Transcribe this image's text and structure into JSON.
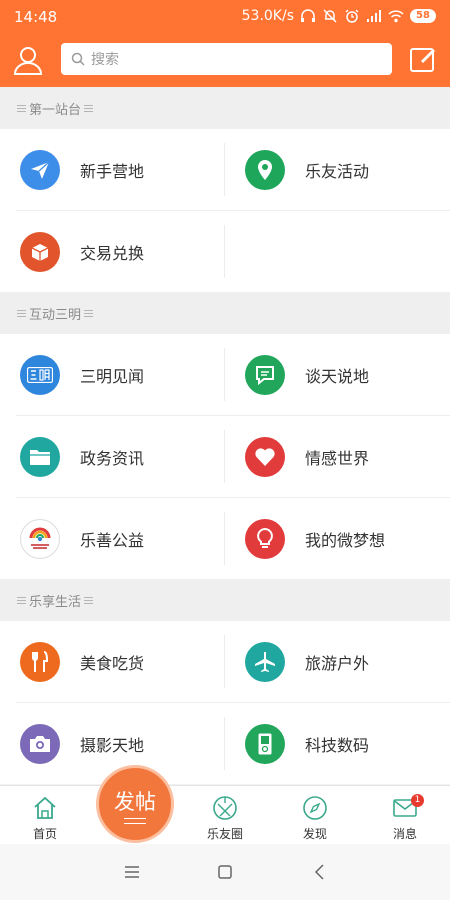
{
  "status_bar": {
    "time": "14:48",
    "net_speed": "53.0K/s",
    "battery": "58"
  },
  "header": {
    "search_placeholder": "搜索"
  },
  "sections": [
    {
      "title": "第一站台",
      "items": [
        {
          "label": "新手营地",
          "icon": "paper-plane-icon",
          "color": "#3d8ee8"
        },
        {
          "label": "乐友活动",
          "icon": "location-pin-icon",
          "color": "#1ea65b"
        },
        {
          "label": "交易兑换",
          "icon": "box-icon",
          "color": "#e2552c"
        }
      ]
    },
    {
      "title": "互动三明",
      "items": [
        {
          "label": "三明见闻",
          "icon": "sanming-icon",
          "color": "#2f86dd"
        },
        {
          "label": "谈天说地",
          "icon": "chat-bubble-icon",
          "color": "#21a65b"
        },
        {
          "label": "政务资讯",
          "icon": "folder-icon",
          "color": "#1fa7a0"
        },
        {
          "label": "情感世界",
          "icon": "heart-icon",
          "color": "#e23b3b"
        },
        {
          "label": "乐善公益",
          "icon": "charity-logo-icon",
          "color": "#ffffff"
        },
        {
          "label": "我的微梦想",
          "icon": "lightbulb-icon",
          "color": "#e23b3b"
        }
      ]
    },
    {
      "title": "乐享生活",
      "items": [
        {
          "label": "美食吃货",
          "icon": "fork-knife-icon",
          "color": "#ee6a1f"
        },
        {
          "label": "旅游户外",
          "icon": "airplane-icon",
          "color": "#1fa7a0"
        },
        {
          "label": "摄影天地",
          "icon": "camera-icon",
          "color": "#7c69b8"
        },
        {
          "label": "科技数码",
          "icon": "device-icon",
          "color": "#21a65b"
        }
      ]
    }
  ],
  "tabbar": {
    "home": "首页",
    "post": "发帖",
    "circle": "乐友圈",
    "discover": "发现",
    "messages": "消息",
    "messages_badge": "1"
  },
  "colors": {
    "brand": "#ff7433",
    "post_button": "#f2773d",
    "badge": "#e8392e"
  }
}
